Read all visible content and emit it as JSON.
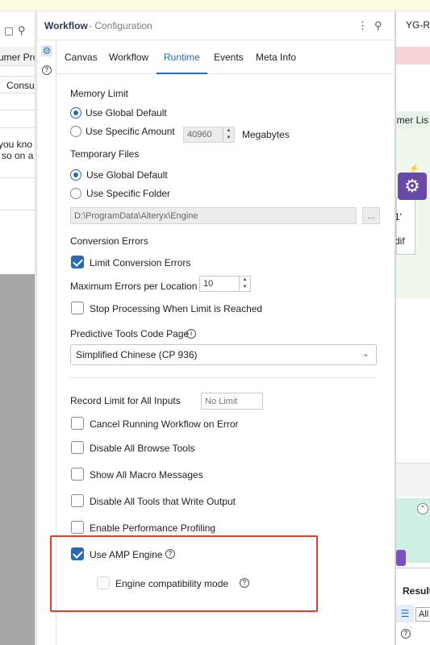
{
  "left_panel": {
    "lines": [
      "umer Pro",
      "Consu",
      "you kno",
      "so on a"
    ]
  },
  "right_panel": {
    "tab_title": "YG-Re",
    "lines": [
      "umer Lis",
      "1'",
      "dif",
      "Results",
      "All"
    ]
  },
  "config": {
    "title": "Workflow",
    "subtitle": "- Configuration",
    "more_icon": "more-vertical-icon",
    "pin_icon": "pin-icon",
    "tabs": [
      "Canvas",
      "Workflow",
      "Runtime",
      "Events",
      "Meta Info"
    ],
    "active_tab": "Runtime"
  },
  "runtime": {
    "memory_limit": {
      "label": "Memory Limit",
      "option_global": "Use Global Default",
      "option_specific": "Use Specific Amount",
      "amount": "40960",
      "unit": "Megabytes"
    },
    "temporary_files": {
      "label": "Temporary Files",
      "option_global": "Use Global Default",
      "option_specific": "Use Specific Folder",
      "folder": "D:\\ProgramData\\Alteryx\\Engine",
      "browse": "..."
    },
    "conversion_errors": {
      "label": "Conversion Errors",
      "limit_label": "Limit Conversion Errors",
      "max_label": "Maximum Errors per Location",
      "max_value": "10",
      "stop_label": "Stop Processing When Limit is Reached"
    },
    "predictive": {
      "label": "Predictive Tools Code Page",
      "selected": "Simplified Chinese (CP 936)"
    },
    "record_limit": {
      "label": "Record Limit for All Inputs",
      "placeholder": "No Limit"
    },
    "options": {
      "cancel_on_error": "Cancel Running Workflow on Error",
      "disable_browse": "Disable All Browse Tools",
      "show_macro": "Show All Macro Messages",
      "disable_output": "Disable All Tools that Write Output",
      "perf_profiling": "Enable Performance Profiling",
      "amp_engine": "Use AMP Engine",
      "compat_mode": "Engine compatibility mode"
    }
  }
}
